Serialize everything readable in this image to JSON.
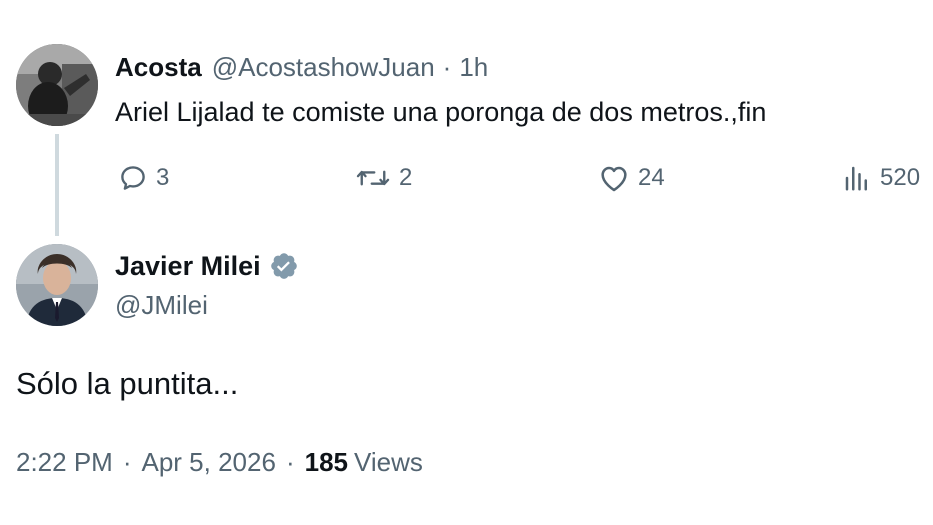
{
  "parent_tweet": {
    "author_name": "Acosta",
    "author_handle": "@AcostashowJuan",
    "separator": "·",
    "time_ago": "1h",
    "text": "Ariel Lijalad te comiste una poronga de dos metros.,fin",
    "actions": {
      "reply_count": "3",
      "retweet_count": "2",
      "like_count": "24",
      "views_count": "520"
    },
    "avatar_icon": "grayscale-photo-avatar"
  },
  "main_tweet": {
    "author_name": "Javier Milei",
    "author_handle": "@JMilei",
    "verified_icon": "verified-badge-icon",
    "text": "Sólo la puntita...",
    "time": "2:22 PM",
    "separator_1": "·",
    "date": "Apr 5, 2026",
    "separator_2": "·",
    "views_count": "185",
    "views_label": "Views",
    "avatar_icon": "portrait-photo-avatar"
  },
  "colors": {
    "text_primary": "#0f1419",
    "text_secondary": "#536471",
    "thread_line": "#cfd9de",
    "verified_badge": "#829aab"
  }
}
